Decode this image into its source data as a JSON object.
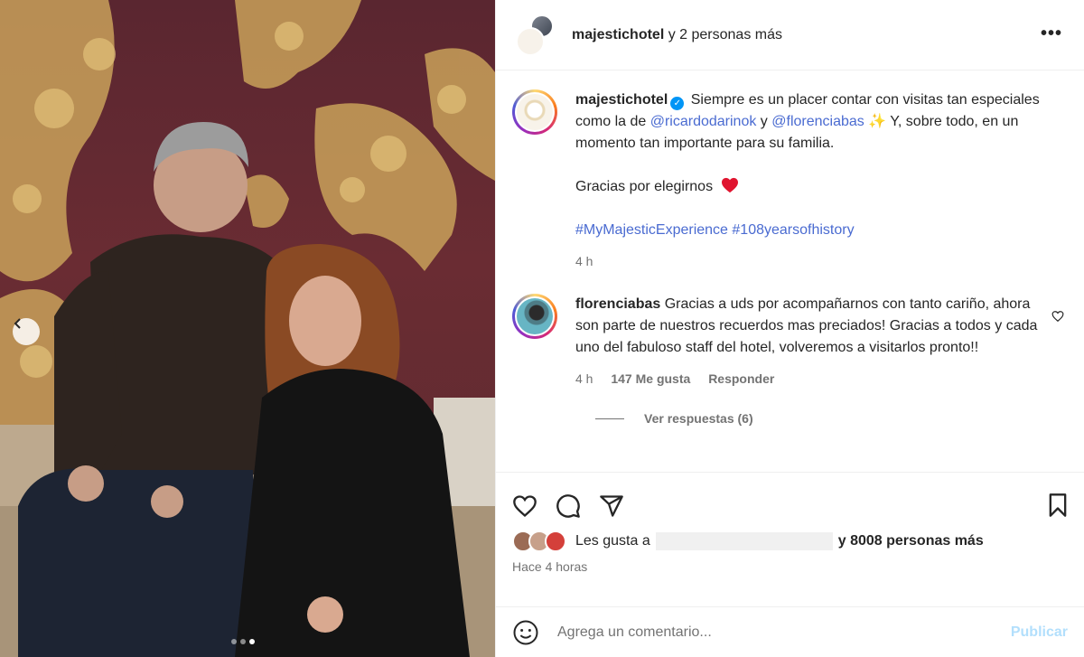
{
  "header": {
    "username": "majestichotel",
    "suffix": "y 2 personas más",
    "more_icon": "•••"
  },
  "caption": {
    "username": "majestichotel",
    "text_1": "Siempre es un placer contar con visitas tan especiales como la de",
    "mention_1": "@ricardodarinok",
    "connector": "y",
    "mention_2": "@florenciabas",
    "emoji": "✨",
    "text_2": "Y, sobre todo, en un momento tan importante para su familia.",
    "thanks": "Gracias por elegirnos",
    "hashtags": "#MyMajesticExperience #108yearsofhistory",
    "time": "4 h"
  },
  "comment": {
    "username": "florenciabas",
    "text": "Gracias a uds por acompañarnos con tanto cariño, ahora son parte de nuestros recuerdos mas preciados! Gracias a todos y cada uno del fabuloso staff del hotel, volveremos a visitarlos pronto!!",
    "time": "4 h",
    "likes": "147 Me gusta",
    "reply": "Responder",
    "view_replies": "Ver respuestas (6)"
  },
  "likes": {
    "prefix": "Les gusta a",
    "suffix_count": "y 8008 personas más",
    "time_ago": "Hace 4 horas"
  },
  "add_comment": {
    "placeholder": "Agrega un comentario...",
    "publish": "Publicar"
  },
  "icons": [
    "heart-icon",
    "comment-icon",
    "share-icon",
    "bookmark-icon",
    "emoji-icon",
    "chevron-left-icon"
  ],
  "carousel": {
    "slide_count": 3,
    "active_index": 2
  }
}
